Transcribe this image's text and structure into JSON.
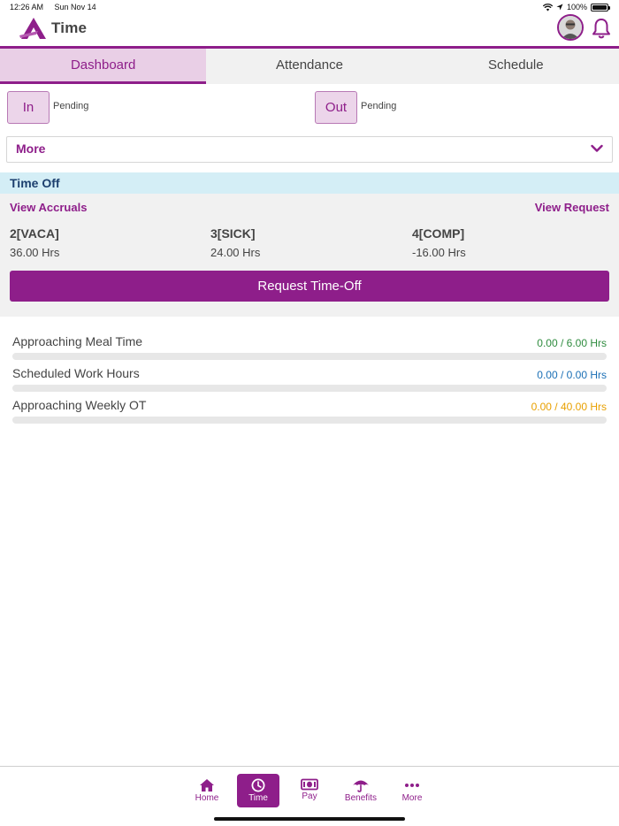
{
  "status_bar": {
    "time": "12:26 AM",
    "date": "Sun Nov 14",
    "battery": "100%",
    "battery_level": 1.0
  },
  "header": {
    "title": "Time"
  },
  "tabs": [
    {
      "label": "Dashboard",
      "active": true
    },
    {
      "label": "Attendance",
      "active": false
    },
    {
      "label": "Schedule",
      "active": false
    }
  ],
  "punch": {
    "in": {
      "label": "In",
      "status": "Pending"
    },
    "out": {
      "label": "Out",
      "status": "Pending"
    }
  },
  "more_dropdown": {
    "label": "More"
  },
  "time_off": {
    "title": "Time Off",
    "view_accruals": "View Accruals",
    "view_request": "View Request",
    "accruals": [
      {
        "code": "2[VACA]",
        "hours": "36.00 Hrs"
      },
      {
        "code": "3[SICK]",
        "hours": "24.00 Hrs"
      },
      {
        "code": "4[COMP]",
        "hours": "-16.00 Hrs"
      }
    ],
    "request_button": "Request Time-Off"
  },
  "progress": [
    {
      "label": "Approaching Meal Time",
      "value": "0.00 / 6.00 Hrs",
      "fraction": 0.0,
      "color": "#2e8b3e"
    },
    {
      "label": "Scheduled Work Hours",
      "value": "0.00 / 0.00 Hrs",
      "fraction": 0.0,
      "color": "#1a6fb5"
    },
    {
      "label": "Approaching Weekly OT",
      "value": "0.00 / 40.00 Hrs",
      "fraction": 0.0,
      "color": "#e8a000"
    }
  ],
  "bottom_nav": [
    {
      "label": "Home",
      "icon": "home-icon",
      "active": false
    },
    {
      "label": "Time",
      "icon": "clock-icon",
      "active": true
    },
    {
      "label": "Pay",
      "icon": "money-icon",
      "active": false
    },
    {
      "label": "Benefits",
      "icon": "umbrella-icon",
      "active": false
    },
    {
      "label": "More",
      "icon": "more-dots-icon",
      "active": false
    }
  ],
  "colors": {
    "brand": "#8e1e8a",
    "timeoff_header_bg": "#d4eef6"
  }
}
